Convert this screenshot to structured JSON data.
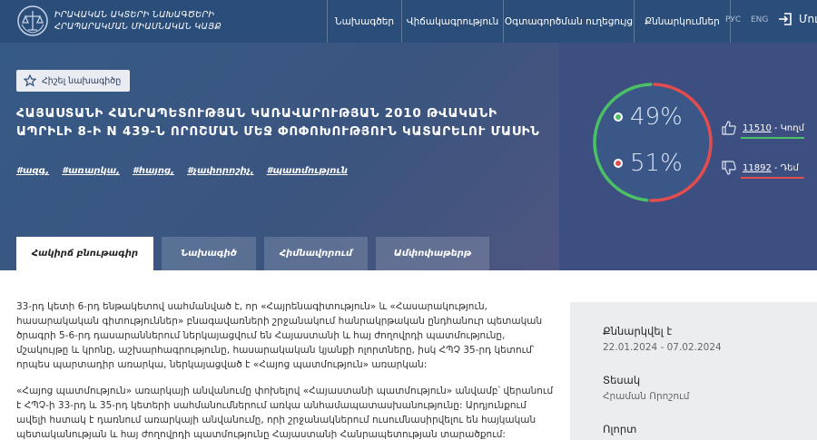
{
  "site": {
    "title_line1": "ԻՐԱՎԱԿԱՆ ԱԿՏԵՐԻ ՆԱԽԱԳԾԵՐԻ",
    "title_line2": "ՀՐԱՊԱՐԱԿՄԱՆ ՄԻԱՍՆԱԿԱՆ ԿԱՅՔ"
  },
  "nav": {
    "items": [
      "Նախագծեր",
      "Վիճակագրություն",
      "Օգտագործման ուղեցույց",
      "Քննարկումներ"
    ],
    "lang": [
      "РУС",
      "ENG"
    ],
    "login": "Մուտք"
  },
  "hero": {
    "favorite_label": "Հիշել նախագիծը",
    "title": "ՀԱՅԱՍՏԱՆԻ ՀԱՆՐԱՊԵՏՈՒԹՅԱՆ ԿԱՌԱՎԱՐՈՒԹՅԱՆ 2010 ԹՎԱԿԱՆԻ ԱՊՐԻԼԻ 8-Ի N 439-Ն ՈՐՈՇՄԱՆ ՄԵՋ ՓՈՓՈԽՈՒԹՅՈՒՆ ԿԱՏԱՐԵԼՈՒ ՄԱՍԻՆ",
    "tags": [
      "#ազգ,",
      "#առարկա,",
      "#հայոց,",
      "#չափորոշիչ,",
      "#պատմություն"
    ],
    "tabs": [
      "Հակիրճ բնութագիր",
      "Նախագիծ",
      "Հիմնավորում",
      "Ամփոփաթերթ"
    ]
  },
  "votes": {
    "yes_pct": "49%",
    "no_pct": "51%",
    "yes_fraction": 0.49,
    "yes_count": "11510",
    "yes_label": "- Կողմ",
    "no_count": "11892",
    "no_label": "- Դեմ",
    "yes_color": "#4cc064",
    "no_color": "#e44d4d"
  },
  "content": {
    "paragraph1": "33-րդ կետի 6-րդ ենթակետով սահմանված է, որ «Հայրենագիտություն» և «Հասարակություն, հասարակական գիտություններ» բնագավառների շրջանակում հանրակրթական ընդհանուր պետական ծրագրի 5-6-րդ դասարաններում ներկայացվում են Հայաստանի և հայ ժողովրդի պատմությունը, մշակույթը և կրոնը, աշխարհագրությունը, հասարակական կյանքի ոլորտները, իսկ ՀՊՉ 35-րդ կետում՝ որպես պարտադիր առարկա, ներկայացված է «Հայոց պատմություն» առարկան:",
    "paragraph2": "«Հայոց պատմություն» առարկայի անվանումը փոխելով «Հայաստանի պատմություն» անվամբ՝ վերանում է ՀՊՉ-ի 33-րդ և 35-րդ կետերի սահմանումներում առկա անհամապատասխանությունը: Արդյունքում ավելի հստակ է դառնում առարկայի անվանումը, որի շրջանակներում ուսումնասիրվելու են հայկական պետականության և հայ ժողովրդի պատմությունը Հայաստանի Հանրապետության տարածքում:"
  },
  "sidebar": {
    "discussed_label": "Քննարկվել է",
    "discussed_value": "22.01.2024 - 07.02.2024",
    "type_label": "Տեսակ",
    "type_value": "Հրաման Որոշում",
    "field_label": "Ոլորտ"
  }
}
